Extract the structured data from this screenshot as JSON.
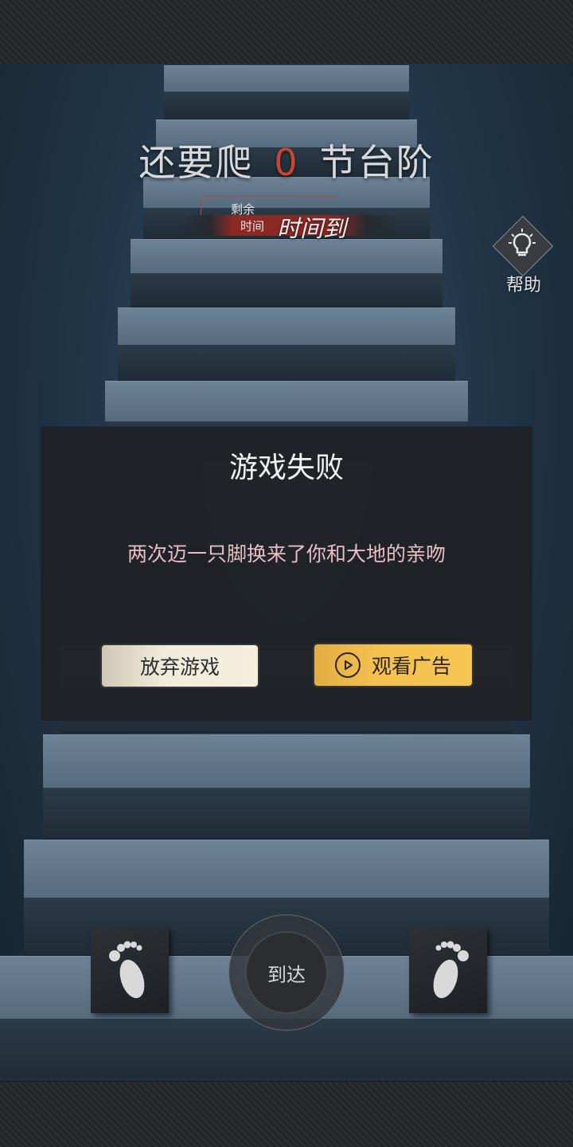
{
  "header": {
    "counter_prefix": "还要爬",
    "counter_value": "0",
    "counter_suffix": "节台阶"
  },
  "timer": {
    "label_line1": "剩余",
    "label_line2": "时间",
    "value": "时间到"
  },
  "help": {
    "label": "帮助",
    "icon": "lightbulb-icon"
  },
  "dialog": {
    "title": "游戏失败",
    "message": "两次迈一只脚换来了你和大地的亲吻",
    "quit_label": "放弃游戏",
    "ad_label": "观看广告",
    "ad_icon": "play-icon"
  },
  "controls": {
    "left_foot_icon": "left-foot-icon",
    "right_foot_icon": "right-foot-icon",
    "arrive_label": "到达"
  },
  "colors": {
    "counter_accent": "#c9452f",
    "ad_button": "#f4c14f",
    "quit_button": "#f1ebdb",
    "message_text": "#e7bfc4"
  }
}
